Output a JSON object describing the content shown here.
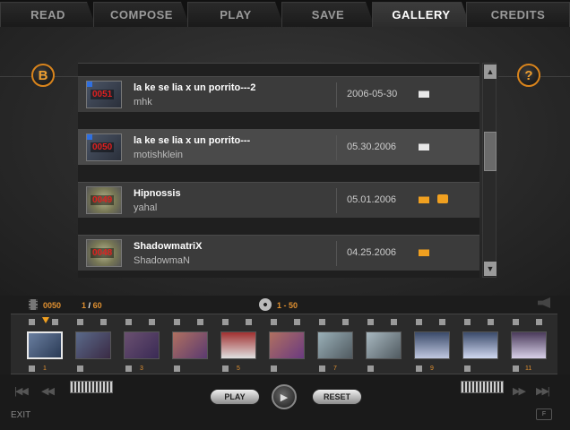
{
  "tabs": [
    {
      "label": "READ",
      "active": false
    },
    {
      "label": "COMPOSE",
      "active": false
    },
    {
      "label": "PLAY",
      "active": false
    },
    {
      "label": "SAVE",
      "active": false
    },
    {
      "label": "GALLERY",
      "active": true
    },
    {
      "label": "CREDITS",
      "active": false
    }
  ],
  "buttons": {
    "back": "B",
    "help": "?"
  },
  "gallery": {
    "items": [
      {
        "id": "0051",
        "title": "la ke se lia x un porrito---2",
        "author": "mhk",
        "date": "2006-05-30",
        "locked": false,
        "selected": false,
        "thumb": "screen"
      },
      {
        "id": "0050",
        "title": "la ke se lia x un porrito---",
        "author": "motishklein",
        "date": "05.30.2006",
        "locked": false,
        "selected": true,
        "thumb": "screen"
      },
      {
        "id": "0049",
        "title": "Hipnossis",
        "author": "yahal",
        "date": "05.01.2006",
        "locked": true,
        "selected": false,
        "thumb": "coin"
      },
      {
        "id": "0048",
        "title": "ShadowmatriX",
        "author": "ShadowmaN",
        "date": "04.25.2006",
        "locked": false,
        "selected": false,
        "thumb": "coin"
      }
    ]
  },
  "film": {
    "movie_id": "0050",
    "current_frame": "1",
    "total_frames": "60",
    "range": "1 - 50",
    "frame_numbers": [
      "1",
      "3",
      "5",
      "7",
      "9",
      "11"
    ]
  },
  "controls": {
    "play": "PLAY",
    "reset": "RESET",
    "exit": "EXIT",
    "fullscreen": "F"
  },
  "colors": {
    "accent": "#f0a020",
    "background": "#1c1c1c"
  }
}
